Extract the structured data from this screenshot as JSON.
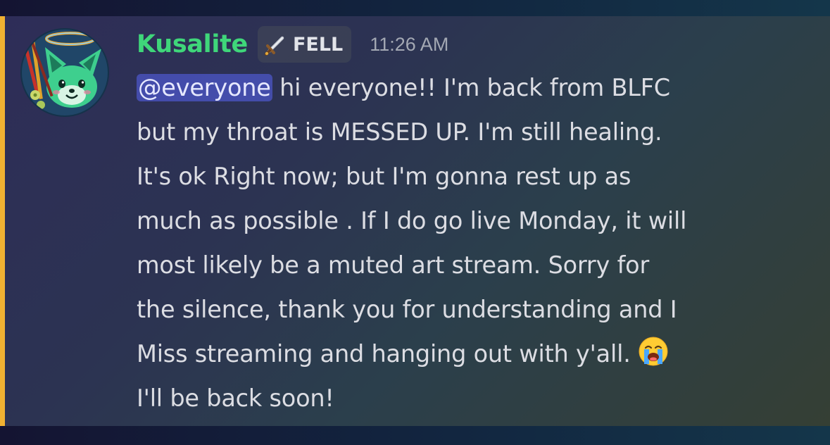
{
  "message": {
    "author": "Kusalite",
    "role_tag": {
      "icon": "sword-icon",
      "label": "FELL"
    },
    "timestamp": "11:26 AM",
    "mention": "@everyone",
    "lines": [
      " hi everyone!! I'm back from BLFC",
      "but my throat is MESSED UP. I'm still healing.",
      "It's ok Right now; but I'm gonna rest up as",
      "much as possible . If I do go live Monday, it will",
      "most likely be a muted art stream. Sorry for",
      "the silence, thank you for understanding and I",
      "Miss streaming and hanging out with y'all. ",
      "I'll be back soon!"
    ],
    "emoji": "loudly-crying-face-icon"
  },
  "colors": {
    "username": "#3fd67a",
    "mention_highlight_bar": "#f0b132",
    "mention_pill": "#5865f2",
    "timestamp": "#a3a8b3"
  }
}
